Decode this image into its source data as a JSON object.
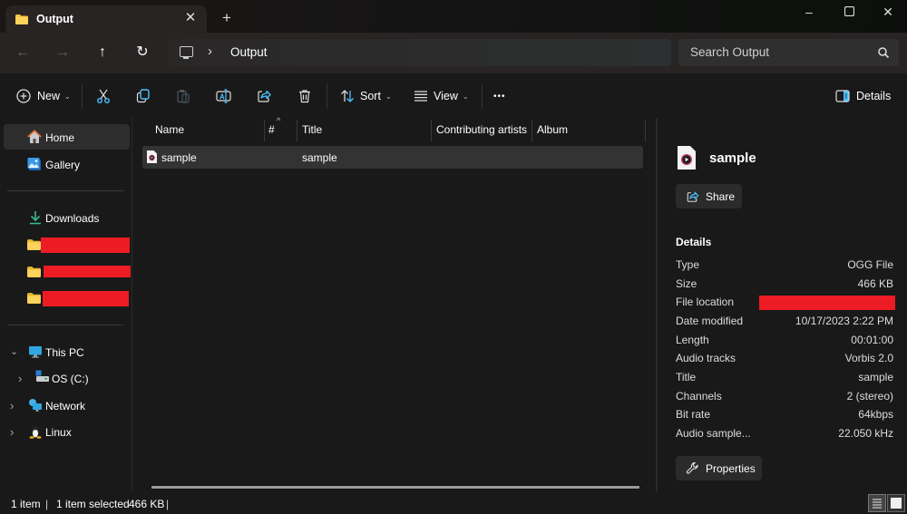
{
  "window": {
    "tab_title": "Output",
    "tab_icon": "folder-icon",
    "new_tab_label": "+",
    "controls": {
      "minimize": "–",
      "maximize": "☐",
      "close": "✕"
    }
  },
  "nav": {
    "back_icon": "←",
    "forward_icon": "→",
    "up_icon": "↑",
    "refresh_icon": "↻",
    "breadcrumb_separator": "›",
    "breadcrumb": [
      "Output"
    ],
    "search_placeholder": "Search Output"
  },
  "toolbar": {
    "new_label": "New",
    "sort_label": "Sort",
    "view_label": "View",
    "more_label": "•••",
    "details_label": "Details",
    "caret": "⌄"
  },
  "sidebar": {
    "home": "Home",
    "gallery": "Gallery",
    "downloads": "Downloads",
    "this_pc": "This PC",
    "os_c": "OS (C:)",
    "network": "Network",
    "linux": "Linux",
    "expanded_chevron": "⌄",
    "collapsed_chevron": "›"
  },
  "file_list": {
    "columns": [
      "Name",
      "#",
      "Title",
      "Contributing artists",
      "Album"
    ],
    "sort_indicator": "^",
    "rows": [
      {
        "name": "sample",
        "number": "",
        "title": "sample",
        "artists": "",
        "album": ""
      }
    ]
  },
  "details_pane": {
    "file_name": "sample",
    "share_label": "Share",
    "section_label": "Details",
    "properties": [
      {
        "key": "Type",
        "value": "OGG File"
      },
      {
        "key": "Size",
        "value": "466 KB"
      },
      {
        "key": "File location",
        "value": "",
        "redacted": true
      },
      {
        "key": "Date modified",
        "value": "10/17/2023 2:22 PM"
      },
      {
        "key": "Length",
        "value": "00:01:00"
      },
      {
        "key": "Audio tracks",
        "value": "Vorbis 2.0"
      },
      {
        "key": "Title",
        "value": "sample"
      },
      {
        "key": "Channels",
        "value": "2 (stereo)"
      },
      {
        "key": "Bit rate",
        "value": "64kbps"
      },
      {
        "key": "Audio sample...",
        "value": "22.050 kHz"
      }
    ],
    "properties_label": "Properties"
  },
  "status": {
    "item_count": "1 item",
    "selected": "1 item selected",
    "size": "466 KB",
    "sep": "|"
  },
  "colors": {
    "accent": "#4cc2ff",
    "redaction": "#ed1c24",
    "folder": "#f8c740"
  }
}
